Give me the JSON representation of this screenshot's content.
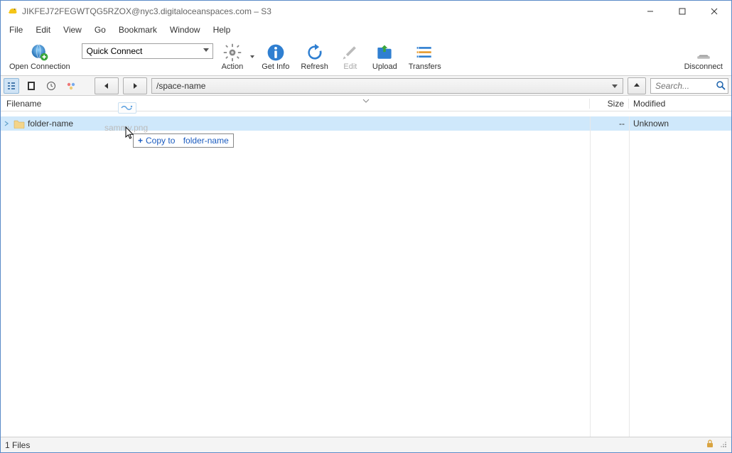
{
  "window": {
    "title": "JIKFEJ72FEGWTQG5RZOX@nyc3.digitaloceanspaces.com – S3"
  },
  "menu": {
    "items": [
      "File",
      "Edit",
      "View",
      "Go",
      "Bookmark",
      "Window",
      "Help"
    ]
  },
  "toolbar": {
    "open_connection": "Open Connection",
    "quick_connect": "Quick Connect",
    "action": "Action",
    "get_info": "Get Info",
    "refresh": "Refresh",
    "edit": "Edit",
    "upload": "Upload",
    "transfers": "Transfers",
    "disconnect": "Disconnect"
  },
  "nav": {
    "path": "/space-name",
    "search_placeholder": "Search..."
  },
  "columns": {
    "filename": "Filename",
    "size": "Size",
    "modified": "Modified"
  },
  "rows": [
    {
      "name": "folder-name",
      "size": "--",
      "modified": "Unknown"
    }
  ],
  "drag": {
    "ghost_label": "sammy.png",
    "tooltip_prefix": "Copy to",
    "tooltip_target": "folder-name"
  },
  "status": {
    "text": "1 Files"
  }
}
